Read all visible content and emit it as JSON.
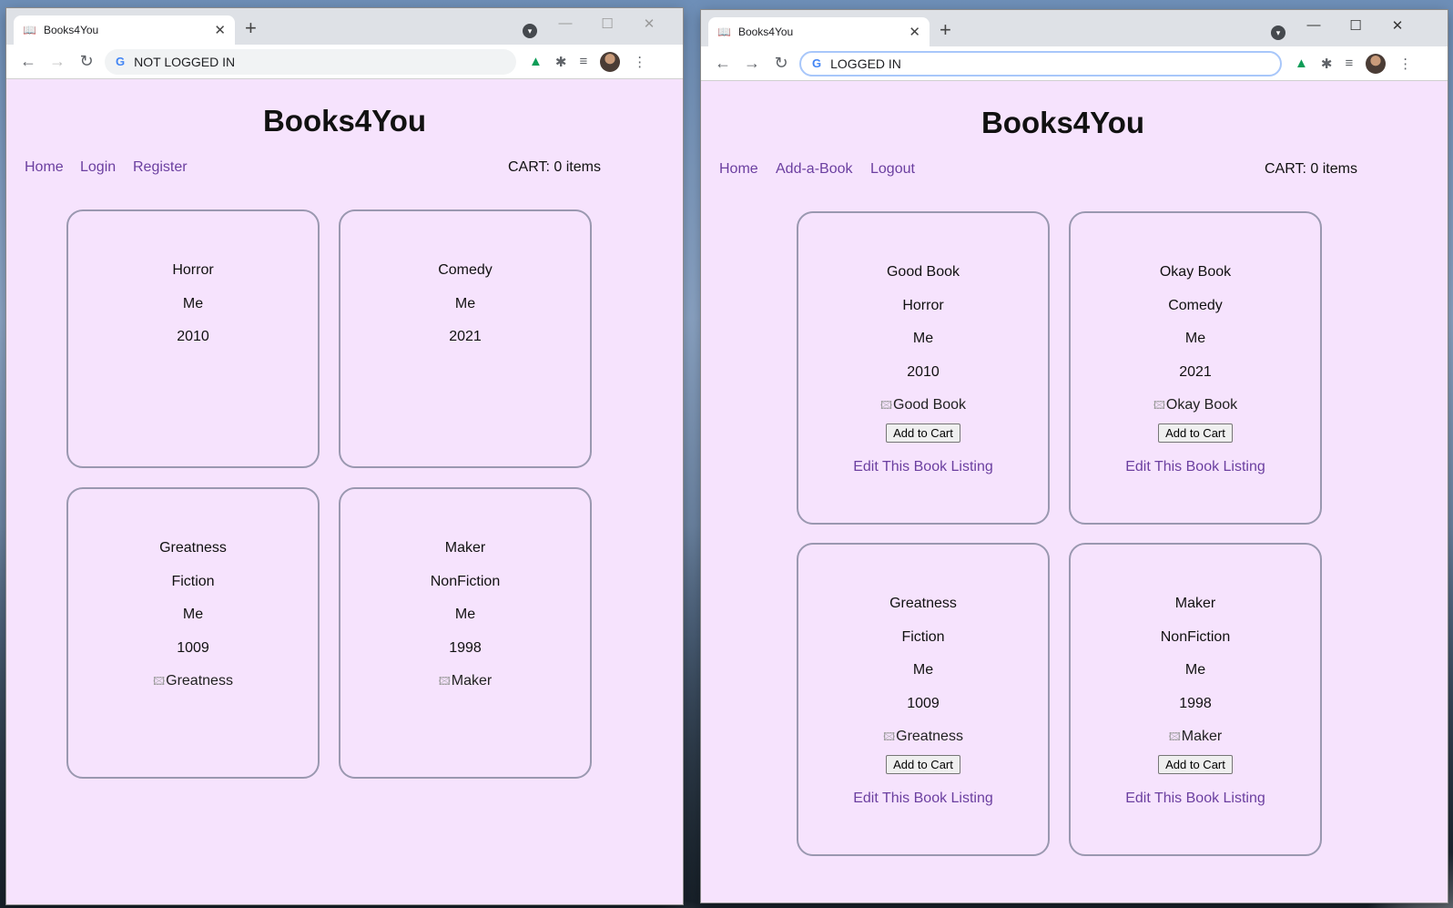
{
  "left": {
    "tab_title": "Books4You",
    "address": "NOT LOGGED IN",
    "site_title": "Books4You",
    "nav": [
      "Home",
      "Login",
      "Register"
    ],
    "cart": "CART: 0 items",
    "books": [
      {
        "lines": [
          "Horror",
          "Me",
          "2010"
        ]
      },
      {
        "lines": [
          "Comedy",
          "Me",
          "2021"
        ]
      },
      {
        "lines": [
          "Greatness",
          "Fiction",
          "Me",
          "1009"
        ],
        "image_alt": "Greatness"
      },
      {
        "lines": [
          "Maker",
          "NonFiction",
          "Me",
          "1998"
        ],
        "image_alt": "Maker"
      }
    ]
  },
  "right": {
    "tab_title": "Books4You",
    "address": "LOGGED IN",
    "site_title": "Books4You",
    "nav": [
      "Home",
      "Add-a-Book",
      "Logout"
    ],
    "cart": "CART: 0 items",
    "add_to_cart": "Add to Cart",
    "edit_link": "Edit This Book Listing",
    "books": [
      {
        "lines": [
          "Good Book",
          "Horror",
          "Me",
          "2010"
        ],
        "image_alt": "Good Book"
      },
      {
        "lines": [
          "Okay Book",
          "Comedy",
          "Me",
          "2021"
        ],
        "image_alt": "Okay Book"
      },
      {
        "lines": [
          "Greatness",
          "Fiction",
          "Me",
          "1009"
        ],
        "image_alt": "Greatness"
      },
      {
        "lines": [
          "Maker",
          "NonFiction",
          "Me",
          "1998"
        ],
        "image_alt": "Maker"
      }
    ]
  },
  "icons": {
    "tab": "book-icon",
    "tab_close": "close-icon",
    "new_tab": "plus-icon",
    "tab_search": "chevron-down-icon",
    "back": "arrow-left-icon",
    "forward": "arrow-right-icon",
    "reload": "reload-icon",
    "google": "google-icon",
    "drive": "drive-icon",
    "extensions": "puzzle-icon",
    "media": "media-queue-icon",
    "profile": "avatar",
    "menu": "more-vertical-icon",
    "minimize": "minimize-icon",
    "maximize": "maximize-icon",
    "close": "close-icon"
  },
  "colors": {
    "page_background": "#f6e3fd",
    "link": "#6b3fa0",
    "card_border": "#9a98b0"
  }
}
